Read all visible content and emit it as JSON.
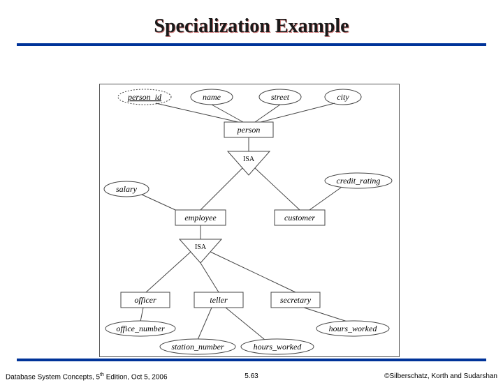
{
  "title": "Specialization Example",
  "diagram": {
    "attributes": {
      "person_id": "person_id",
      "name": "name",
      "street": "street",
      "city": "city",
      "salary": "salary",
      "credit_rating": "credit_rating",
      "office_number": "office_number",
      "station_number": "station_number",
      "hours_worked_teller": "hours_worked",
      "hours_worked_secretary": "hours_worked"
    },
    "entities": {
      "person": "person",
      "employee": "employee",
      "customer": "customer",
      "officer": "officer",
      "teller": "teller",
      "secretary": "secretary"
    },
    "isa_label": "ISA"
  },
  "footer": {
    "book": "Database System Concepts, 5",
    "book_sup": "th",
    "book_tail": " Edition, Oct 5, 2006",
    "page": "5.63",
    "copyright": "©Silberschatz, Korth and Sudarshan"
  }
}
